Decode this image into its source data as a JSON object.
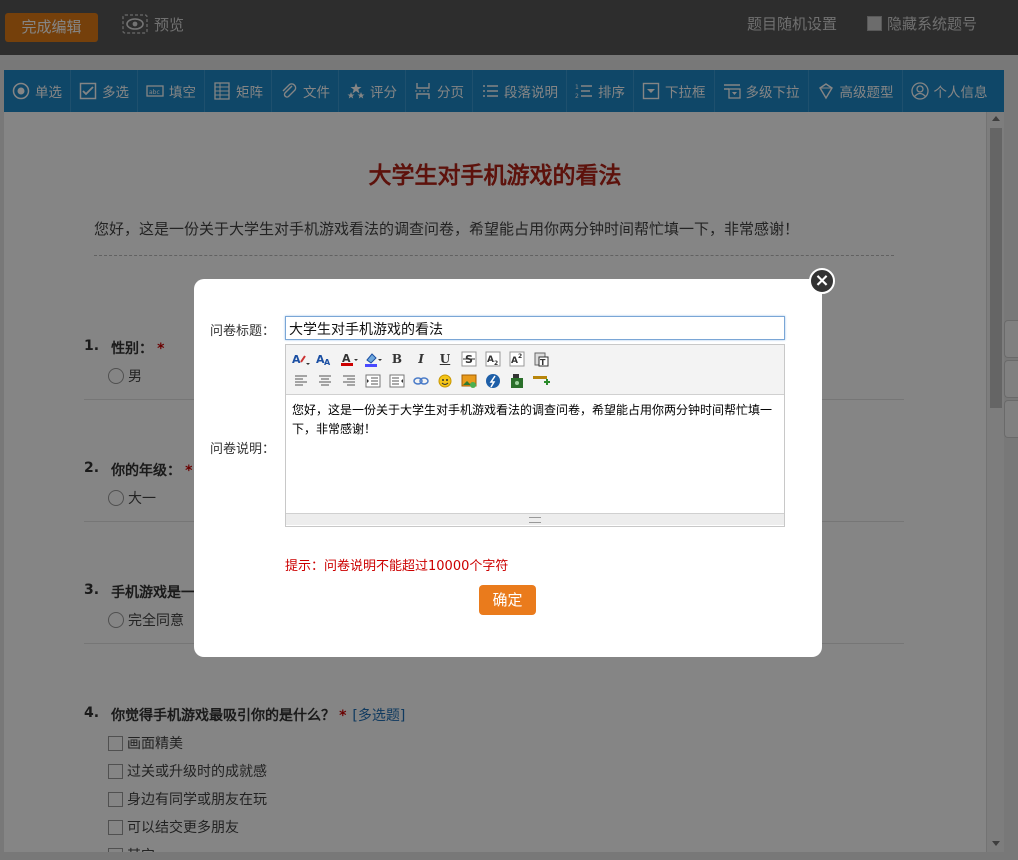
{
  "topbar": {
    "done_label": "完成编辑",
    "preview_label": "预览",
    "random_label": "题目随机设置",
    "hide_number_label": "隐藏系统题号"
  },
  "toolbar": {
    "items": [
      {
        "label": "单选",
        "icon": "radio-icon"
      },
      {
        "label": "多选",
        "icon": "checkbox-icon"
      },
      {
        "label": "填空",
        "icon": "fill-blank-icon"
      },
      {
        "label": "矩阵",
        "icon": "matrix-icon"
      },
      {
        "label": "文件",
        "icon": "paperclip-icon"
      },
      {
        "label": "评分",
        "icon": "stars-icon"
      },
      {
        "label": "分页",
        "icon": "page-break-icon"
      },
      {
        "label": "段落说明",
        "icon": "paragraph-icon"
      },
      {
        "label": "排序",
        "icon": "sort-icon"
      },
      {
        "label": "下拉框",
        "icon": "dropdown-icon"
      },
      {
        "label": "多级下拉",
        "icon": "multi-dropdown-icon"
      },
      {
        "label": "高级题型",
        "icon": "advanced-icon"
      },
      {
        "label": "个人信息",
        "icon": "user-icon"
      }
    ]
  },
  "survey": {
    "title": "大学生对手机游戏的看法",
    "description": "您好，这是一份关于大学生对手机游戏看法的调查问卷，希望能占用你两分钟时间帮忙填一下，非常感谢！",
    "questions": [
      {
        "num": "1.",
        "title": "性别：",
        "required": "*",
        "options": [
          "男"
        ]
      },
      {
        "num": "2.",
        "title": "你的年级：",
        "required": "*",
        "options": [
          "大一"
        ]
      },
      {
        "num": "3.",
        "title": "手机游戏是一",
        "options": [
          "完全同意"
        ]
      },
      {
        "num": "4.",
        "title": "你觉得手机游戏最吸引你的是什么？",
        "required": "*",
        "tag": "[多选题]",
        "options": [
          "画面精美",
          "过关或升级时的成就感",
          "身边有同学或朋友在玩",
          "可以结交更多朋友",
          "其它"
        ]
      }
    ]
  },
  "dialog": {
    "title_label": "问卷标题：",
    "title_value": "大学生对手机游戏的看法",
    "desc_label": "问卷说明：",
    "desc_value": "您好，这是一份关于大学生对手机游戏看法的调查问卷，希望能占用你两分钟时间帮忙填一下，非常感谢！",
    "hint": "提示：问卷说明不能超过10000个字符",
    "ok_label": "确定",
    "close_symbol": "×"
  },
  "colors": {
    "accent_orange": "#e07b16",
    "toolbar_blue": "#1e88c7",
    "title_red": "#b32317",
    "hint_red": "#cc0000"
  }
}
